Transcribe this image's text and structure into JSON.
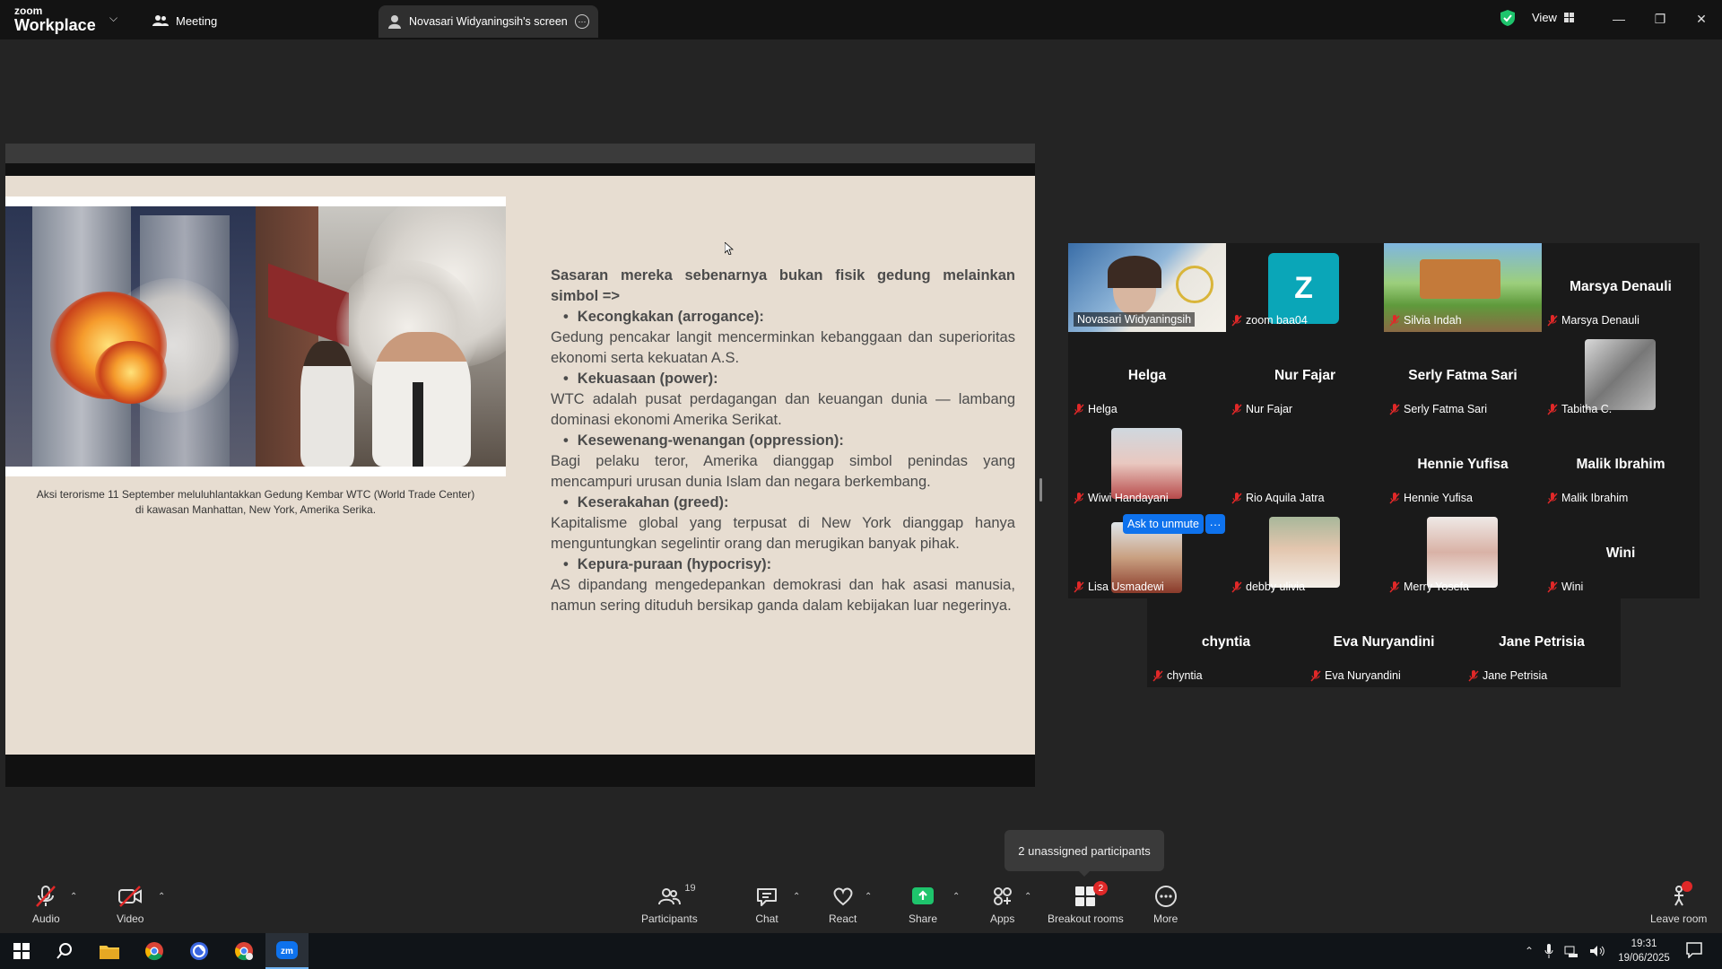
{
  "titlebar": {
    "brand_top": "zoom",
    "brand_bottom": "Workplace",
    "meeting_tab": "Meeting",
    "screen_tab": "Novasari Widyaningsih's screen",
    "view_label": "View"
  },
  "slide": {
    "caption_line1": "Aksi terorisme 11 September meluluhlantakkan Gedung Kembar WTC (World Trade Center)",
    "caption_line2": "di kawasan Manhattan, New York, Amerika Serika.",
    "lead": "Sasaran mereka sebenarnya bukan fisik gedung melainkan simbol =>",
    "points": [
      {
        "title": "Kecongkakan (arrogance):",
        "body": "Gedung pencakar langit mencerminkan kebanggaan dan superioritas ekonomi serta kekuatan A.S."
      },
      {
        "title": "Kekuasaan (power):",
        "body": " WTC adalah pusat perdagangan dan keuangan dunia — lambang dominasi ekonomi Amerika Serikat."
      },
      {
        "title": "Kesewenang-wenangan (oppression):",
        "body": "Bagi pelaku teror, Amerika dianggap simbol penindas yang mencampuri urusan dunia Islam dan negara berkembang."
      },
      {
        "title": "Keserakahan (greed):",
        "body": "Kapitalisme global yang terpusat di New York dianggap hanya menguntungkan segelintir orang dan merugikan banyak pihak."
      },
      {
        "title": "Kepura-puraan (hypocrisy):",
        "body": "AS dipandang mengedepankan demokrasi dan hak asasi manusia, namun sering dituduh bersikap ganda dalam kebijakan luar negerinya."
      }
    ]
  },
  "gallery": {
    "tiles": [
      {
        "label": "Novasari Widyaningsih",
        "big": ""
      },
      {
        "label": "zoom baa04",
        "big": "",
        "avatar": "Z"
      },
      {
        "label": "Silvia Indah",
        "big": ""
      },
      {
        "label": "Marsya Denauli",
        "big": "Marsya Denauli"
      },
      {
        "label": "Helga",
        "big": "Helga"
      },
      {
        "label": "Nur Fajar",
        "big": "Nur Fajar"
      },
      {
        "label": "Serly Fatma Sari",
        "big": "Serly Fatma Sari"
      },
      {
        "label": "Tabitha C.",
        "big": ""
      },
      {
        "label": "Wiwi Handayani",
        "big": ""
      },
      {
        "label": "Rio Aquila Jatra",
        "big": ""
      },
      {
        "label": "Hennie Yufisa",
        "big": "Hennie Yufisa"
      },
      {
        "label": "Malik Ibrahim",
        "big": "Malik Ibrahim"
      },
      {
        "label": "Lisa Usmadewi",
        "big": ""
      },
      {
        "label": "debby ulivia",
        "big": ""
      },
      {
        "label": "Merry Yosefa",
        "big": ""
      },
      {
        "label": "Wini",
        "big": "Wini"
      },
      {
        "label": "chyntia",
        "big": "chyntia"
      },
      {
        "label": "Eva Nuryandini",
        "big": "Eva Nuryandini"
      },
      {
        "label": "Jane Petrisia",
        "big": "Jane Petrisia"
      }
    ],
    "ask_unmute": "Ask to unmute",
    "ask_more": "···",
    "unassigned": "2 unassigned participants"
  },
  "controls": {
    "audio": "Audio",
    "video": "Video",
    "participants": "Participants",
    "participants_count": "19",
    "chat": "Chat",
    "react": "React",
    "share": "Share",
    "apps": "Apps",
    "breakout": "Breakout rooms",
    "breakout_badge": "2",
    "more": "More",
    "leave": "Leave room"
  },
  "taskbar": {
    "time": "19:31",
    "date": "19/06/2025"
  },
  "colors": {
    "accent_green": "#2bd59c",
    "share_green": "#1ec46c",
    "zoom_blue": "#0e72ed",
    "muted_red": "#e02828",
    "slide_bg": "#e7ddd1"
  }
}
